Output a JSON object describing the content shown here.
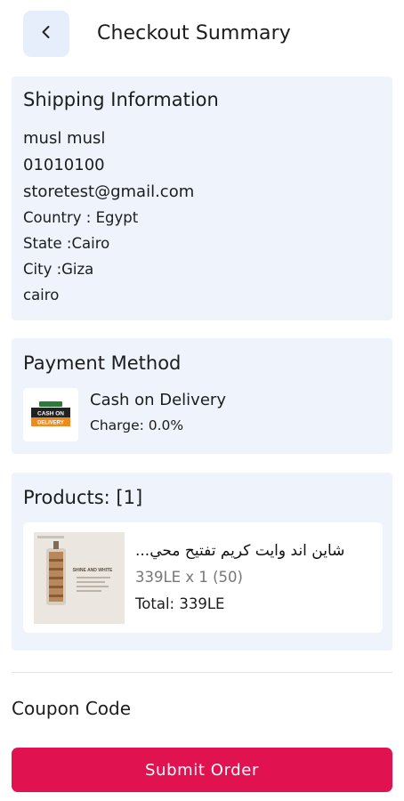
{
  "header": {
    "title": "Checkout Summary",
    "back_icon": "chevron-left-icon"
  },
  "shipping": {
    "title": "Shipping Information",
    "name": "musl musl",
    "phone": "01010100",
    "email": "storetest@gmail.com",
    "country": "Country : Egypt",
    "state": "State :Cairo",
    "city": "City :Giza",
    "address": "cairo"
  },
  "payment": {
    "title": "Payment Method",
    "method": "Cash on Delivery",
    "charge": "Charge: 0.0%",
    "logo_text_top": "CASH ON",
    "logo_text_bottom": "DELIVERY"
  },
  "products": {
    "title": "Products: [1]",
    "items": [
      {
        "name": "شاين اند وايت كريم تفتيح محي...",
        "price_qty": "339LE x 1 (50)",
        "total": "Total: 339LE",
        "thumb_caption": "SHINE AND WHITE"
      }
    ]
  },
  "coupon": {
    "label": "Coupon Code"
  },
  "submit": {
    "label": "Submit Order"
  },
  "colors": {
    "accent": "#e0124f",
    "card_bg": "#eef3fc",
    "back_btn_bg": "#e7eefb"
  }
}
